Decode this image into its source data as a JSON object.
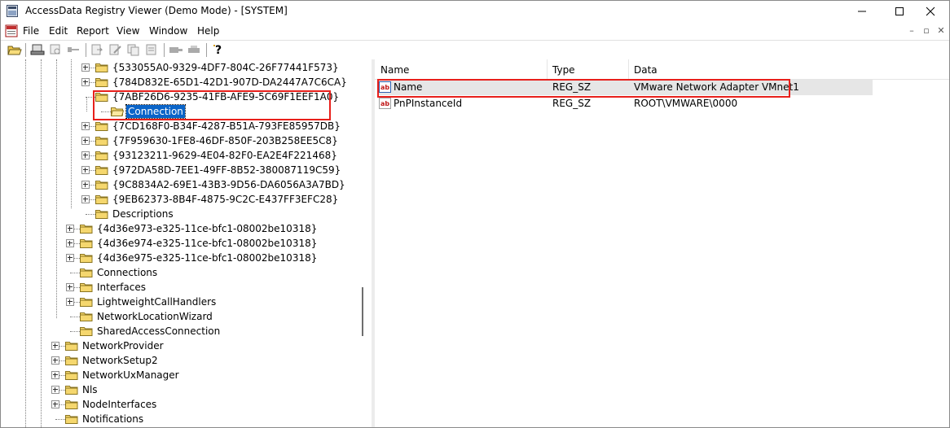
{
  "window": {
    "title": "AccessData Registry Viewer (Demo Mode) - [SYSTEM]",
    "app_icon": "registry-viewer-icon",
    "controls": [
      "minimize-icon",
      "maximize-icon",
      "close-icon"
    ]
  },
  "menu": {
    "items": [
      "File",
      "Edit",
      "Report",
      "View",
      "Window",
      "Help"
    ],
    "mdi_controls": [
      "mdi-minimize-icon",
      "mdi-restore-icon",
      "mdi-close-icon"
    ]
  },
  "toolbar": {
    "buttons": [
      "open-icon",
      "report-icon",
      "find-icon",
      "key-icon",
      "export-icon",
      "edit-icon",
      "copy-icon",
      "properties-icon",
      "view-icon",
      "print-icon",
      "help-icon"
    ]
  },
  "tree": {
    "nodes": [
      {
        "label": "{533055A0-9329-4DF7-804C-26F77441F573}",
        "expander": true
      },
      {
        "label": "{784D832E-65D1-42D1-907D-DA2447A7C6CA}",
        "expander": true
      },
      {
        "label": "{7ABF26D6-9235-41FB-AFE9-5C69F1EEF1A0}",
        "expander": false
      },
      {
        "label": "Connection",
        "expander": false,
        "selected": true
      },
      {
        "label": "{7CD168F0-B34F-4287-B51A-793FE85957DB}",
        "expander": true
      },
      {
        "label": "{7F959630-1FE8-46DF-850F-203B258EE5C8}",
        "expander": true
      },
      {
        "label": "{93123211-9629-4E04-82F0-EA2E4F221468}",
        "expander": true
      },
      {
        "label": "{972DA58D-7EE1-49FF-8B52-380087119C59}",
        "expander": true
      },
      {
        "label": "{9C8834A2-69E1-43B3-9D56-DA6056A3A7BD}",
        "expander": true
      },
      {
        "label": "{9EB62373-8B4F-4875-9C2C-E437FF3EFC28}",
        "expander": true
      },
      {
        "label": "Descriptions",
        "expander": false
      },
      {
        "label": "{4d36e973-e325-11ce-bfc1-08002be10318}",
        "expander": true
      },
      {
        "label": "{4d36e974-e325-11ce-bfc1-08002be10318}",
        "expander": true
      },
      {
        "label": "{4d36e975-e325-11ce-bfc1-08002be10318}",
        "expander": true
      },
      {
        "label": "Connections",
        "expander": false
      },
      {
        "label": "Interfaces",
        "expander": true
      },
      {
        "label": "LightweightCallHandlers",
        "expander": true
      },
      {
        "label": "NetworkLocationWizard",
        "expander": false
      },
      {
        "label": "SharedAccessConnection",
        "expander": false
      },
      {
        "label": "NetworkProvider",
        "expander": true
      },
      {
        "label": "NetworkSetup2",
        "expander": true
      },
      {
        "label": "NetworkUxManager",
        "expander": true
      },
      {
        "label": "Nls",
        "expander": true
      },
      {
        "label": "NodeInterfaces",
        "expander": true
      },
      {
        "label": "Notifications",
        "expander": false
      }
    ]
  },
  "list": {
    "columns": [
      "Name",
      "Type",
      "Data"
    ],
    "rows": [
      {
        "name": "Name",
        "type": "REG_SZ",
        "data": "VMware Network Adapter VMnet1",
        "icon": "reg-sz-icon"
      },
      {
        "name": "PnPInstanceId",
        "type": "REG_SZ",
        "data": "ROOT\\VMWARE\\0000",
        "icon": "reg-sz-icon"
      }
    ]
  },
  "colors": {
    "selection": "#0a64c8",
    "highlight_box": "#e8201b",
    "folder": "#f5d76e"
  }
}
